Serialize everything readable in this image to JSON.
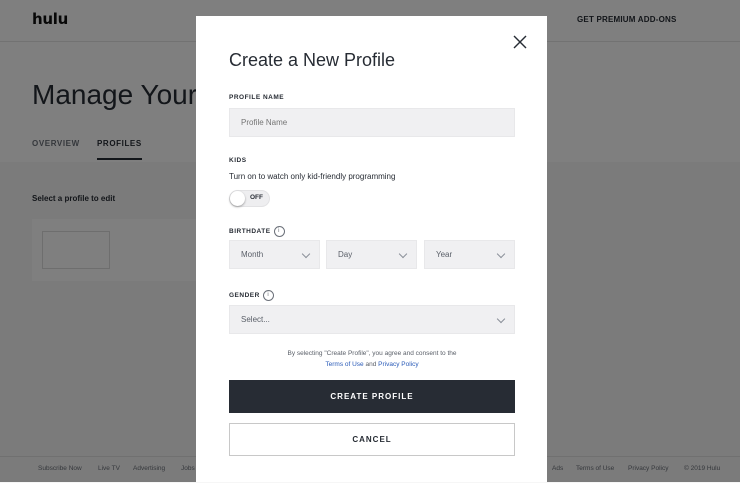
{
  "header": {
    "logo": "hulu",
    "premium_link": "GET PREMIUM ADD-ONS"
  },
  "page": {
    "title": "Manage Your",
    "tabs": [
      {
        "label": "OVERVIEW",
        "active": false
      },
      {
        "label": "PROFILES",
        "active": true
      }
    ],
    "select_hint": "Select a profile to edit"
  },
  "footer": {
    "left_links": [
      "Subscribe Now",
      "Live TV",
      "Advertising",
      "Jobs"
    ],
    "right_links": [
      "Ads",
      "Terms of Use",
      "Privacy Policy",
      "© 2019 Hulu"
    ]
  },
  "modal": {
    "title": "Create a New Profile",
    "profile_name": {
      "label": "PROFILE NAME",
      "placeholder": "Profile Name",
      "value": ""
    },
    "kids": {
      "label": "KIDS",
      "description": "Turn on to watch only kid-friendly programming",
      "toggle_text": "OFF",
      "enabled": false
    },
    "birthdate": {
      "label": "BIRTHDATE",
      "info_icon": "i",
      "month": "Month",
      "day": "Day",
      "year": "Year"
    },
    "gender": {
      "label": "GENDER",
      "info_icon": "i",
      "value": "Select..."
    },
    "consent": {
      "prefix": "By selecting \"Create Profile\", you agree and consent to the",
      "terms": "Terms of Use",
      "and": "and",
      "privacy": "Privacy Policy"
    },
    "create_button": "CREATE PROFILE",
    "cancel_button": "CANCEL"
  },
  "colors": {
    "primary_button": "#272c34",
    "link": "#2a5bb8",
    "overlay": "rgba(0,0,0,0.5)"
  }
}
